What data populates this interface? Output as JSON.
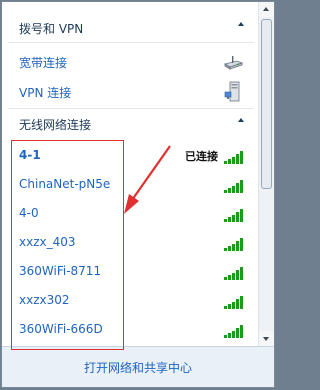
{
  "sections": {
    "dialup_vpn": {
      "title": "拨号和 VPN"
    },
    "wireless": {
      "title": "无线网络连接"
    }
  },
  "connections": [
    {
      "label": "宽带连接",
      "icon": "broadband-modem-icon"
    },
    {
      "label": "VPN 连接",
      "icon": "vpn-computer-icon"
    }
  ],
  "networks": [
    {
      "name": "4-1",
      "status": "已连接",
      "connected": true,
      "signal_bars": 5
    },
    {
      "name": "ChinaNet-pN5e",
      "status": "",
      "connected": false,
      "signal_bars": 5
    },
    {
      "name": "4-0",
      "status": "",
      "connected": false,
      "signal_bars": 5
    },
    {
      "name": "xxzx_403",
      "status": "",
      "connected": false,
      "signal_bars": 5
    },
    {
      "name": "360WiFi-8711",
      "status": "",
      "connected": false,
      "signal_bars": 5
    },
    {
      "name": "xxzx302",
      "status": "",
      "connected": false,
      "signal_bars": 5
    },
    {
      "name": "360WiFi-666D",
      "status": "",
      "connected": false,
      "signal_bars": 5
    }
  ],
  "footer": {
    "link": "打开网络和共享中心"
  },
  "colors": {
    "link": "#1f64c0",
    "signal": "#1c9a1c",
    "highlight": "#e03030",
    "arrow": "#e03030"
  }
}
